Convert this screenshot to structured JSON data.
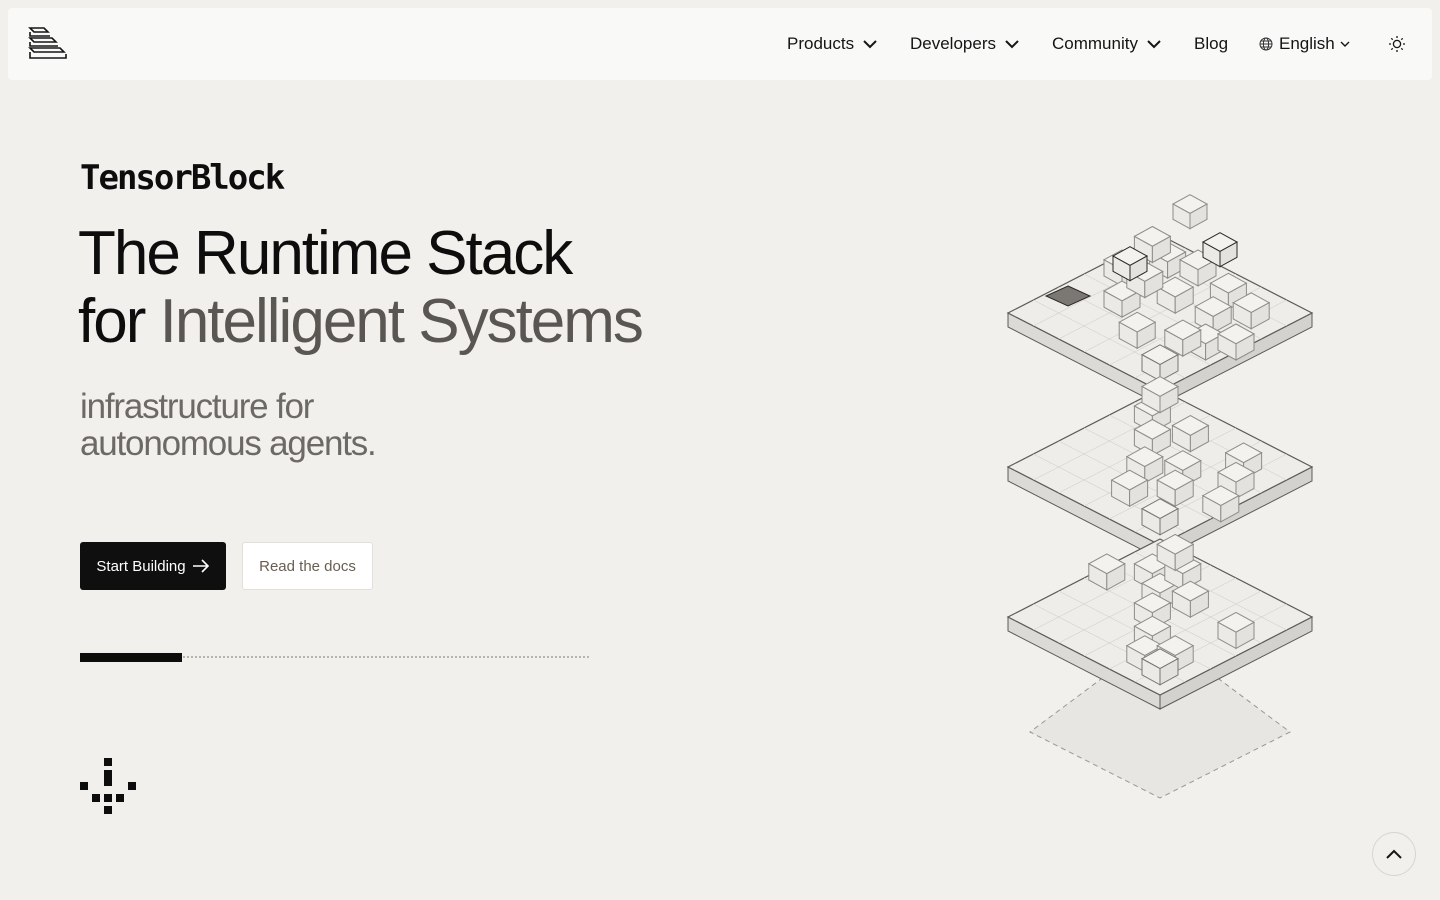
{
  "nav": {
    "items": [
      {
        "label": "Products",
        "has_dropdown": true
      },
      {
        "label": "Developers",
        "has_dropdown": true
      },
      {
        "label": "Community",
        "has_dropdown": true
      },
      {
        "label": "Blog",
        "has_dropdown": false
      }
    ],
    "language": "English",
    "icons": {
      "logo": "stack-logo-icon",
      "globe": "globe-icon",
      "theme": "sun-icon"
    }
  },
  "hero": {
    "brand": "TensorBlock",
    "headline_line1": "The Runtime Stack",
    "headline_line2_prefix": "for ",
    "headline_line2_accent": "Intelligent Systems",
    "subline_line1": "infrastructure for",
    "subline_line2": "autonomous agents.",
    "primary_cta": "Start Building",
    "secondary_cta": "Read the docs",
    "progress_fraction": 0.2
  },
  "colors": {
    "background": "#f1f0ed",
    "navbar": "#f9f9f8",
    "text": "#0d0d0d",
    "accent_text": "#5a5652",
    "primary_button": "#0f0f0f"
  }
}
